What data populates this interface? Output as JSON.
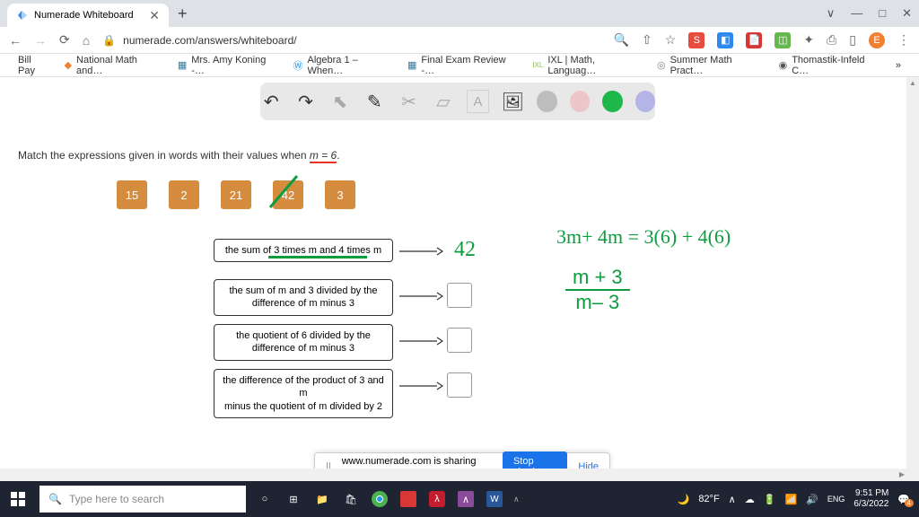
{
  "browser": {
    "tab_title": "Numerade Whiteboard",
    "url": "numerade.com/answers/whiteboard/"
  },
  "window_controls": {
    "min": "—",
    "max": "□",
    "close": "✕",
    "chevron": "∨"
  },
  "nav": {
    "back": "←",
    "fwd": "→",
    "reload": "⟳",
    "home": "⌂",
    "lock": "🔒",
    "search": "🔍",
    "share": "⇧",
    "star": "☆",
    "cast": "⎙",
    "ext": "✦",
    "menu": "⋮"
  },
  "ext_icons": {
    "red_s": {
      "bg": "#e84c3d",
      "txt": "S"
    },
    "blue": {
      "bg": "#2d89ef",
      "txt": "◧"
    },
    "pdf": {
      "bg": "#d73835",
      "txt": "📄"
    },
    "green": {
      "bg": "#64b84c",
      "txt": "◫"
    },
    "orange": {
      "bg": "#f08030",
      "txt": "E"
    }
  },
  "bookmarks": [
    {
      "label": "Bill Pay",
      "icon": ""
    },
    {
      "label": "National Math and…",
      "icon": "◆"
    },
    {
      "label": "Mrs. Amy Koning -…",
      "icon": "▦"
    },
    {
      "label": "Algebra 1 – When…",
      "icon": "Ⓦ"
    },
    {
      "label": "Final Exam Review -…",
      "icon": "▦"
    },
    {
      "label": "IXL | Math, Languag…",
      "icon": "IXL"
    },
    {
      "label": "Summer Math Pract…",
      "icon": "◎"
    },
    {
      "label": "Thomastik-Infeld C…",
      "icon": "◉"
    }
  ],
  "bookmarks_more": "»",
  "toolbar": {
    "undo": "↶",
    "redo": "↷",
    "pointer": "⬉",
    "pen": "✎",
    "tools": "✂",
    "eraser": "▱",
    "text": "A",
    "image": "🖼"
  },
  "colors": {
    "grey": "#bdbdbd",
    "pink": "#eec6c9",
    "green": "#1db74a",
    "purple": "#b4b4e6"
  },
  "question": {
    "prefix": "Match the expressions given in words with their values when ",
    "cond": "m = 6",
    "suffix": "."
  },
  "chips": [
    "15",
    "2",
    "21",
    "42",
    "3"
  ],
  "expressions": [
    {
      "text": "the sum of 3 times m and 4 times m",
      "underlined": true,
      "answer": "42"
    },
    {
      "text_l1": "the sum of m and 3 divided by the",
      "text_l2": "difference of m minus 3",
      "answer": ""
    },
    {
      "text_l1": "the quotient of 6 divided by the",
      "text_l2": "difference of m minus 3",
      "answer": ""
    },
    {
      "text_l1": "the difference of the product of 3 and m",
      "text_l2": "minus the quotient of m divided by 2",
      "answer": ""
    }
  ],
  "handwriting": {
    "line1": "3m+ 4m  = 3(6) + 4(6)",
    "frac_top": "m + 3",
    "frac_bot": "m– 3"
  },
  "share": {
    "msg": "www.numerade.com is sharing your screen.",
    "stop": "Stop sharing",
    "hide": "Hide"
  },
  "taskbar": {
    "search_placeholder": "Type here to search",
    "weather_temp": "82°F",
    "weather_icon": "🌙",
    "time": "9:51 PM",
    "date": "6/3/2022",
    "notif": "4"
  }
}
